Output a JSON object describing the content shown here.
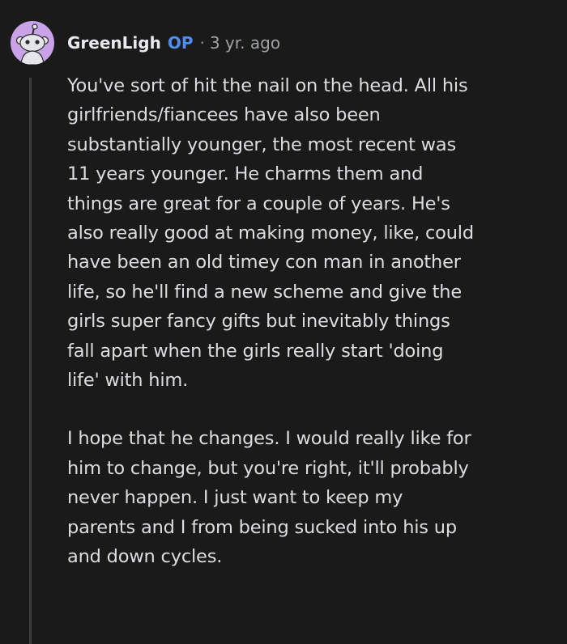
{
  "comment": {
    "author": "GreenLigh",
    "flair": "OP",
    "separator": "·",
    "timestamp": "3 yr. ago",
    "avatar_icon": "snoo-avatar-icon",
    "colors": {
      "background": "#1a1a1b",
      "text": "#dcdde0",
      "op_badge": "#4f8cf0",
      "avatar_bg": "#c9a2e8",
      "thread_line": "#3b3c3e"
    },
    "paragraphs": [
      "You've sort of hit the nail on the head. All his\ngirlfriends/fiancees have also been\nsubstantially younger, the most recent was\n11 years younger. He charms them and\nthings are great for a couple of years. He's\nalso really good at making money, like, could\nhave been an old timey con man in another\nlife, so he'll find a new scheme and give the\ngirls super fancy gifts but inevitably things\nfall apart when the girls really start 'doing\nlife' with him.",
      "I hope that he changes. I would really like for\nhim to change, but you're right, it'll probably\nnever happen. I just want to keep my\nparents and I from being sucked into his up\nand down cycles."
    ]
  }
}
